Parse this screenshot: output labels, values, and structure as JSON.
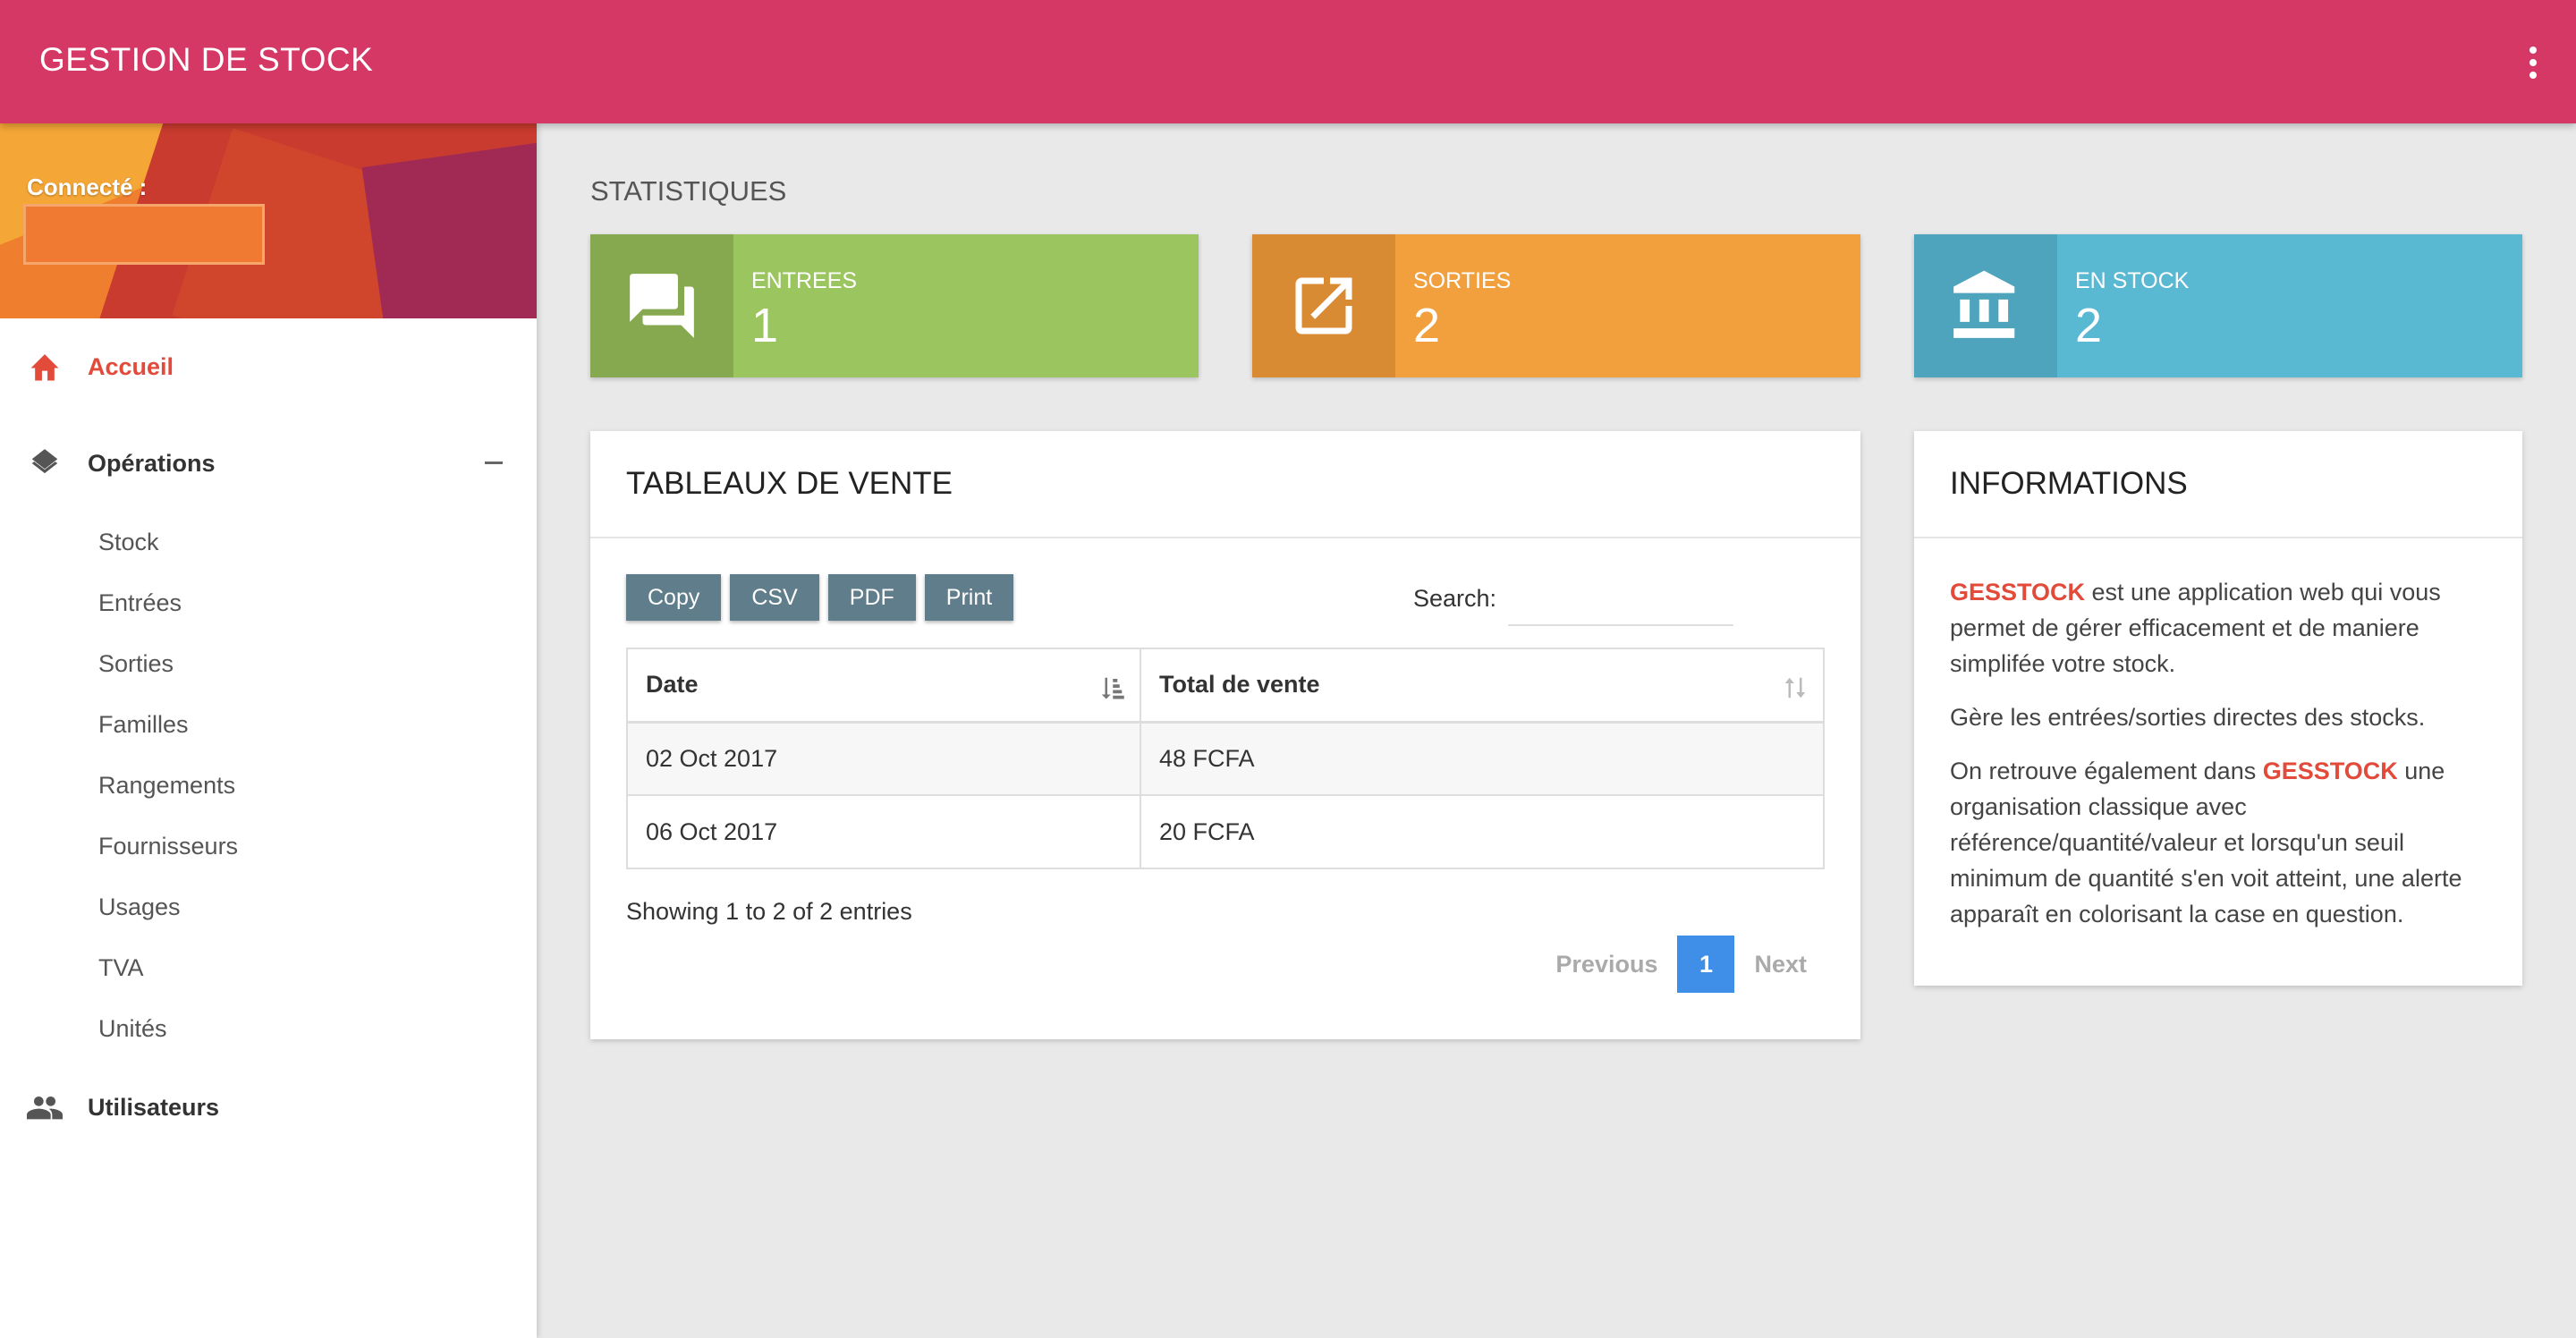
{
  "header": {
    "title": "GESTION DE STOCK",
    "menu_icon": "more-vert-icon"
  },
  "sidebar": {
    "connected_label": "Connecté :",
    "home": {
      "label": "Accueil",
      "icon": "home-icon"
    },
    "operations": {
      "label": "Opérations",
      "icon": "layers-icon",
      "items": [
        "Stock",
        "Entrées",
        "Sorties",
        "Familles",
        "Rangements",
        "Fournisseurs",
        "Usages",
        "TVA",
        "Unités"
      ]
    },
    "users": {
      "label": "Utilisateurs",
      "icon": "people-icon"
    }
  },
  "stats": {
    "section_title": "STATISTIQUES",
    "cards": [
      {
        "title": "ENTREES",
        "value": "1",
        "icon": "forum-icon",
        "color": "#9bc65f",
        "icon_bg": "#86a950"
      },
      {
        "title": "SORTIES",
        "value": "2",
        "icon": "open-in-new-icon",
        "color": "#f2a03d",
        "icon_bg": "#d98b33"
      },
      {
        "title": "EN STOCK",
        "value": "2",
        "icon": "bank-icon",
        "color": "#59b9d3",
        "icon_bg": "#4ea4bd"
      }
    ]
  },
  "sales": {
    "title": "TABLEAUX DE VENTE",
    "buttons": [
      "Copy",
      "CSV",
      "PDF",
      "Print"
    ],
    "search_label": "Search:",
    "search_value": "",
    "columns": [
      "Date",
      "Total de vente"
    ],
    "rows": [
      [
        "02 Oct 2017",
        "48 FCFA"
      ],
      [
        "06 Oct 2017",
        "20 FCFA"
      ]
    ],
    "showing": "Showing 1 to 2 of 2 entries",
    "pager": {
      "previous": "Previous",
      "page": "1",
      "next": "Next"
    }
  },
  "info": {
    "title": "INFORMATIONS",
    "brand": "GESSTOCK",
    "p1_rest": " est une application web qui vous permet de gérer efficacement et de maniere simplifée votre stock.",
    "p2": "Gère les entrées/sorties directes des stocks.",
    "p3_start": "On retrouve également dans ",
    "p3_rest": " une organisation classique avec référence/quantité/valeur et lorsqu'un seuil minimum de quantité s'en voit atteint, une alerte apparaît en colorisant la case en question."
  },
  "colors": {
    "topbar": "#d63865",
    "accent": "#e24a3a",
    "page_active": "#3f8ee8",
    "button": "#607d8b"
  }
}
